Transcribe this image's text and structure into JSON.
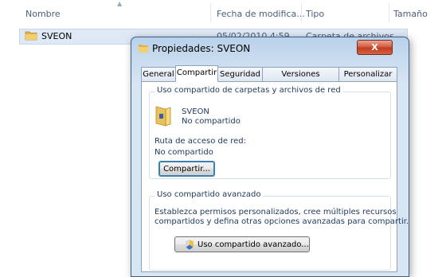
{
  "explorer": {
    "columns": {
      "name": "Nombre",
      "date": "Fecha de modifica...",
      "type": "Tipo",
      "size": "Tamaño"
    },
    "file": {
      "name": "SVEON",
      "date": "05/02/2010 4:59",
      "type": "Carpeta de archivos"
    }
  },
  "dialog": {
    "title": "Propiedades: SVEON",
    "close_label": "X",
    "tabs": [
      "General",
      "Compartir",
      "Seguridad",
      "Versiones anteriores",
      "Personalizar"
    ],
    "active_tab": "Compartir",
    "network_group": {
      "title": "Uso compartido de carpetas y archivos de red",
      "folder_name": "SVEON",
      "folder_status": "No compartido",
      "path_label": "Ruta de acceso de red:",
      "path_value": "No compartido",
      "share_button": "Compartir..."
    },
    "advanced_group": {
      "title": "Uso compartido avanzado",
      "description_line1": "Establezca permisos personalizados, cree múltiples recursos",
      "description_line2": "compartidos y defina otras opciones avanzadas para compartir.",
      "advanced_button": "Uso compartido avanzado..."
    }
  },
  "colors": {
    "accent": "#3c7fb1",
    "close_red": "#c13a1c",
    "text_blue": "#1e395b"
  },
  "icons": [
    "folder-icon",
    "shield-icon",
    "close-icon"
  ]
}
